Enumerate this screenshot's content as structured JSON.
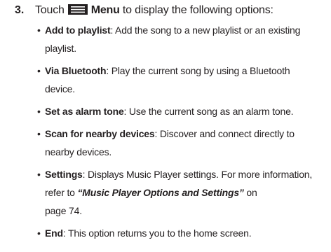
{
  "step": {
    "number": "3.",
    "text_before_icon": "Touch",
    "icon": "menu-icon",
    "menu_label": "Menu",
    "text_after": " to display the following options:"
  },
  "options": [
    {
      "name": "Add to playlist",
      "line1": ": Add the song to a new playlist or an existing",
      "line2": "playlist."
    },
    {
      "name": "Via Bluetooth",
      "line1": ": Play the current song by using a Bluetooth",
      "line2": "device."
    },
    {
      "name": "Set as alarm tone",
      "line1": ": Use the current song as an alarm tone."
    },
    {
      "name": "Scan for nearby devices",
      "line1": ": Discover and connect directly to",
      "line2": "nearby devices."
    },
    {
      "name": "Settings",
      "line1": ": Displays Music Player settings. For more information,",
      "line2_prefix": "refer to ",
      "line2_link": "“Music Player Options and Settings”",
      "line2_suffix": " on",
      "line3": "page 74."
    },
    {
      "name": "End",
      "line1": ": This option returns you to the home screen."
    }
  ],
  "bullet_char": "•",
  "colors": {
    "text": "#231f20"
  }
}
